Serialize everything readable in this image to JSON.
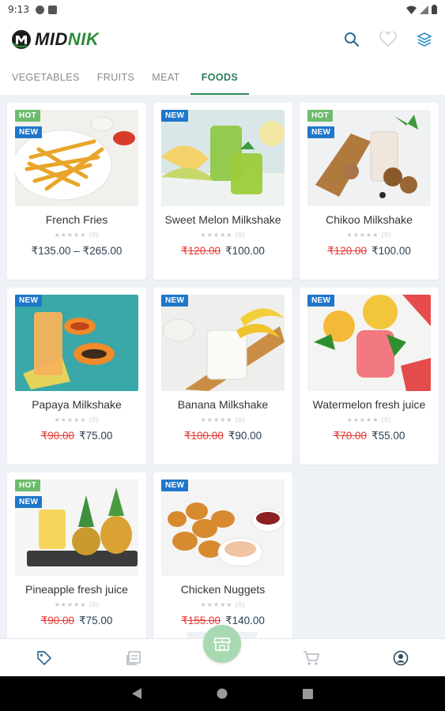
{
  "status_bar": {
    "time": "9:13"
  },
  "header": {
    "logo_prefix": "MID",
    "logo_suffix": "NIK",
    "icons": [
      "search-icon",
      "heart-icon",
      "layers-icon"
    ]
  },
  "tabs": [
    {
      "label": "VEGETABLES",
      "active": false
    },
    {
      "label": "FRUITS",
      "active": false
    },
    {
      "label": "MEAT",
      "active": false
    },
    {
      "label": "FOODS",
      "active": true
    }
  ],
  "products": [
    {
      "name": "French Fries",
      "badges": [
        "HOT",
        "NEW"
      ],
      "rating": "★★★★★ (0)",
      "price": "₹135.00 – ₹265.00",
      "old_price": ""
    },
    {
      "name": "Sweet Melon Milkshake",
      "badges": [
        "NEW"
      ],
      "rating": "★★★★★ (0)",
      "price": "₹100.00",
      "old_price": "₹120.00"
    },
    {
      "name": "Chikoo Milkshake",
      "badges": [
        "HOT",
        "NEW"
      ],
      "rating": "★★★★★ (0)",
      "price": "₹100.00",
      "old_price": "₹120.00"
    },
    {
      "name": "Papaya Milkshake",
      "badges": [
        "NEW"
      ],
      "rating": "★★★★★ (0)",
      "price": "₹75.00",
      "old_price": "₹90.00"
    },
    {
      "name": "Banana Milkshake",
      "badges": [
        "NEW"
      ],
      "rating": "★★★★★ (0)",
      "price": "₹90.00",
      "old_price": "₹100.00"
    },
    {
      "name": "Watermelon fresh juice",
      "badges": [
        "NEW"
      ],
      "rating": "★★★★★ (0)",
      "price": "₹55.00",
      "old_price": "₹70.00"
    },
    {
      "name": "Pineapple fresh juice",
      "badges": [
        "HOT",
        "NEW"
      ],
      "rating": "★★★★★ (0)",
      "price": "₹75.00",
      "old_price": "₹90.00"
    },
    {
      "name": "Chicken Nuggets",
      "badges": [
        "NEW"
      ],
      "rating": "★★★★★ (0)",
      "price": "₹140.00",
      "old_price": "₹155.00"
    }
  ],
  "bottom_nav": [
    "tag-icon",
    "orders-icon",
    "store-icon",
    "cart-icon",
    "account-icon"
  ],
  "colors": {
    "brand_green": "#2e8b3c",
    "new_badge": "#1f77c9",
    "hot_badge": "#6dbb6d",
    "sale_red": "#e53935",
    "fab": "#a8d9b0"
  }
}
